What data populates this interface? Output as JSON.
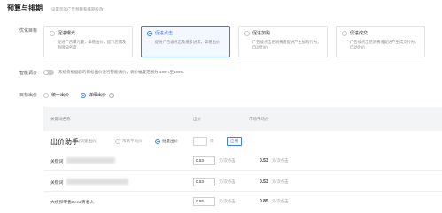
{
  "header": {
    "title": "预算与排期",
    "subtitle": "设置您的广告预算和排期投放"
  },
  "labels": {
    "goal": "优化目标",
    "smart_bid": "智能调价",
    "target_bid": "目标出价"
  },
  "goal_cards": [
    {
      "title": "促进曝光",
      "desc": "促进广告曝光量，拿稳出价，提升店铺及品牌知名度",
      "selected": false
    },
    {
      "title": "促进点击",
      "desc": "促进广告被点击及增多进来，拿稳出价",
      "selected": true
    },
    {
      "title": "促进加购",
      "desc": "广告被点击后消费者促进产生加购行为，自动出价",
      "selected": false
    },
    {
      "title": "促进成交",
      "desc": "广告被点击后消费者促进产生成交行为，自动出价",
      "selected": false
    }
  ],
  "smart_bid": {
    "enabled": false,
    "desc": "系统将根据您的目标出价进行智能调价，调价幅度范围为-100%至100%"
  },
  "bid_mode": {
    "options": [
      "统一出价",
      "详细出价"
    ],
    "selected": "详细出价",
    "help_icon": "question-circle-icon"
  },
  "table": {
    "headers": [
      "关键词名称",
      "出价",
      "市场平均价"
    ],
    "helper": {
      "title": "出价助手",
      "sub": "(快速出价)",
      "opt_market": "市场平均价",
      "opt_batch": "批量出价",
      "opt_batch_selected": true,
      "input_value": "",
      "unit": "元",
      "apply": "应用"
    },
    "rows": [
      {
        "keyword": "关键词",
        "bid": "0.53",
        "bid_unit": "元/次点击",
        "avg": "0.53",
        "avg_unit": "元/次点击"
      },
      {
        "keyword": "关键词",
        "bid": "0.53",
        "bid_unit": "元/次点击",
        "avg": "0.53",
        "avg_unit": "元/次点击"
      },
      {
        "keyword": "大侦探零售Benz青春人",
        "bid": "0.85",
        "bid_unit": "元/次点击",
        "avg": "0.85",
        "avg_unit": "元/次点击"
      }
    ]
  },
  "colors": {
    "accent": "#3b7cf5",
    "header_bg": "#f3f4f6"
  }
}
